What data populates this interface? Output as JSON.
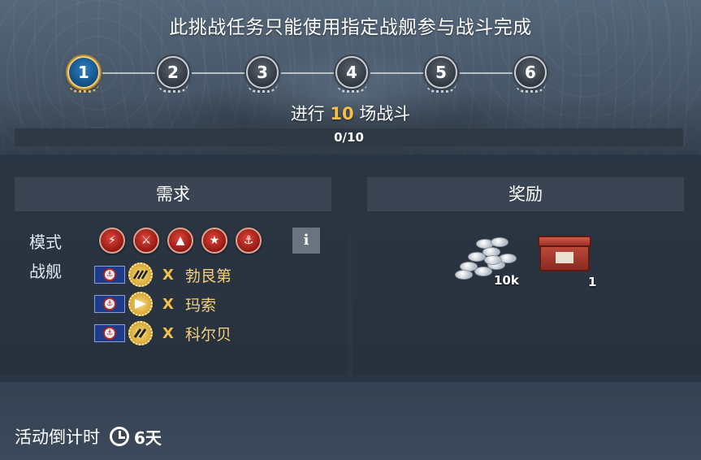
{
  "header": {
    "title": "此挑战任务只能使用指定战舰参与战斗完成",
    "steps": [
      "1",
      "2",
      "3",
      "4",
      "5",
      "6"
    ],
    "active_step": 1,
    "task_prefix": "进行",
    "task_count": "10",
    "task_suffix": "场战斗",
    "progress_text": "0/10",
    "progress_fraction": 0.0
  },
  "requirements": {
    "heading": "需求",
    "mode_label": "模式",
    "ship_label": "战舰",
    "modes": [
      "mode-icon",
      "mode-icon",
      "mode-icon",
      "mode-icon",
      "mode-icon"
    ],
    "info_label": "i",
    "ships": [
      {
        "tier_glyph": "VIII",
        "x": "X",
        "name": "勃艮第"
      },
      {
        "tier_glyph": "▶",
        "x": "X",
        "name": "玛索"
      },
      {
        "tier_glyph": "VII",
        "x": "X",
        "name": "科尔贝"
      }
    ]
  },
  "rewards": {
    "heading": "奖励",
    "items": [
      {
        "icon": "credits-icon",
        "count": "10k"
      },
      {
        "icon": "crate-icon",
        "count": "1"
      }
    ]
  },
  "footer": {
    "countdown_label": "活动倒计时",
    "countdown_value": "6天"
  },
  "colors": {
    "accent_gold": "#f4c04a",
    "ship_name": "#f2cf7a",
    "active_step": "#1a5fa0",
    "mode_red": "#c8281e"
  }
}
